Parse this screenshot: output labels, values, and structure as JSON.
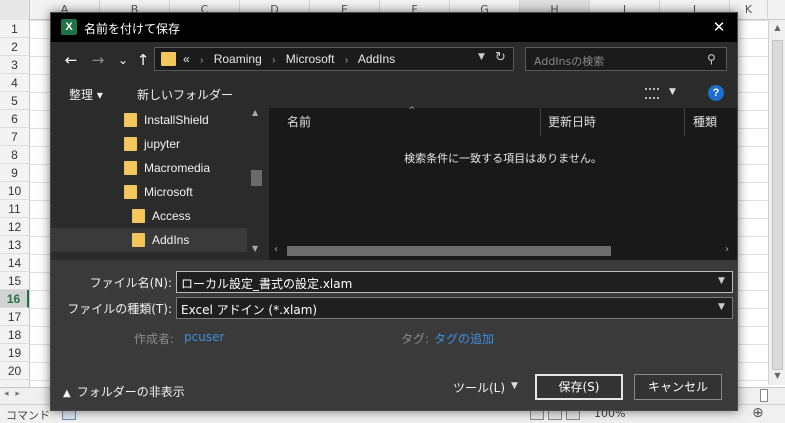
{
  "excel": {
    "column_letters": [
      "A",
      "B",
      "C",
      "D",
      "E",
      "F",
      "G",
      "H",
      "I",
      "J",
      "K"
    ],
    "row_numbers": [
      "1",
      "2",
      "3",
      "4",
      "5",
      "6",
      "7",
      "8",
      "9",
      "10",
      "11",
      "12",
      "13",
      "14",
      "15",
      "16",
      "17",
      "18",
      "19",
      "20"
    ],
    "selected_row": "16",
    "status_mode": "コマンド",
    "zoom": "100%"
  },
  "dialog": {
    "title": "名前を付けて保存",
    "app_icon_letter": "X",
    "close": "✕",
    "nav": {
      "back": "←",
      "forward": "→",
      "recent": "⌄",
      "up": "↑"
    },
    "address": {
      "overflow": "«",
      "crumbs": [
        "Roaming",
        "Microsoft",
        "AddIns"
      ]
    },
    "search_placeholder": "AddInsの検索",
    "toolbar": {
      "organize": "整理 ▾",
      "new_folder": "新しいフォルダー"
    },
    "tree": [
      {
        "label": "InstallShield",
        "selected": false
      },
      {
        "label": "jupyter",
        "selected": false
      },
      {
        "label": "Macromedia",
        "selected": false
      },
      {
        "label": "Microsoft",
        "selected": false
      },
      {
        "label": "Access",
        "selected": false
      },
      {
        "label": "AddIns",
        "selected": true
      }
    ],
    "columns": {
      "name": "名前",
      "modified": "更新日時",
      "type": "種類"
    },
    "empty_message": "検索条件に一致する項目はありません。",
    "filename_label": "ファイル名(N):",
    "filename_value": "ローカル設定_書式の設定.xlam",
    "filetype_label": "ファイルの種類(T):",
    "filetype_value": "Excel アドイン (*.xlam)",
    "author_label": "作成者:",
    "author_value": "pcuser",
    "tags_label": "タグ:",
    "tags_value": "タグの追加",
    "hide_folders": "フォルダーの非表示",
    "tools": "ツール(L)",
    "save": "保存(S)",
    "cancel": "キャンセル"
  }
}
